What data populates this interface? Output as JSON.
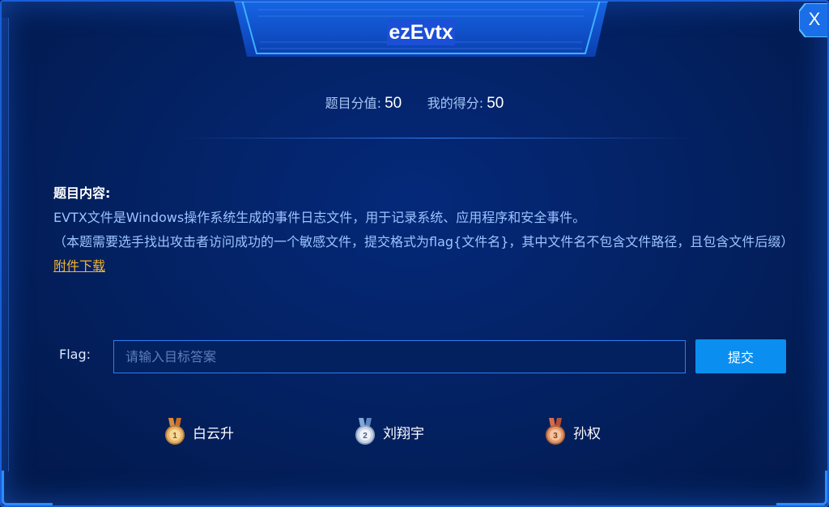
{
  "title": "ezEvtx",
  "close_label": "X",
  "score": {
    "challenge_score_label": "题目分值:",
    "challenge_score_value": "50",
    "my_score_label": "我的得分:",
    "my_score_value": "50"
  },
  "content": {
    "heading": "题目内容:",
    "line1": "EVTX文件是Windows操作系统生成的事件日志文件，用于记录系统、应用程序和安全事件。",
    "line2": "（本题需要选手找出攻击者访问成功的一个敏感文件，提交格式为flag{文件名}，其中文件名不包含文件路径，且包含文件后缀）",
    "attachment_link": "附件下载"
  },
  "flag": {
    "label": "Flag:",
    "placeholder": "请输入目标答案",
    "value": "",
    "submit_label": "提交"
  },
  "winners": [
    {
      "rank": "1",
      "name": "白云升",
      "medal": "gold-medal-icon",
      "color": "#e7b56a"
    },
    {
      "rank": "2",
      "name": "刘翔宇",
      "medal": "silver-medal-icon",
      "color": "#c8d4e6"
    },
    {
      "rank": "3",
      "name": "孙权",
      "medal": "bronze-medal-icon",
      "color": "#e59a6c"
    }
  ],
  "colors": {
    "background": "#03205f",
    "accent": "#0a8ff0",
    "link": "#f2b533",
    "text": "#9cc4ff"
  }
}
